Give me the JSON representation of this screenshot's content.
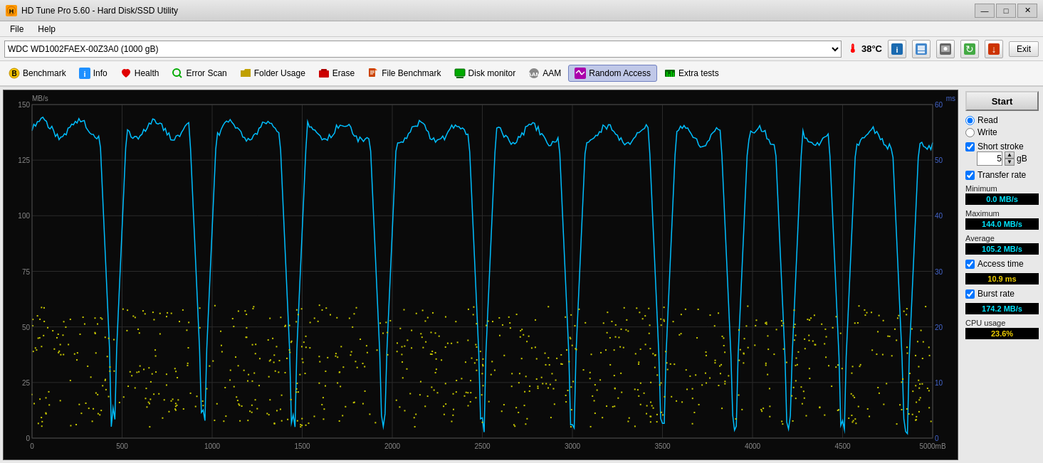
{
  "titlebar": {
    "icon": "HD",
    "title": "HD Tune Pro 5.60 - Hard Disk/SSD Utility",
    "minimize": "—",
    "maximize": "□",
    "close": "✕"
  },
  "menubar": {
    "items": [
      "File",
      "Help"
    ]
  },
  "toolbar": {
    "tabs": [
      {
        "id": "benchmark",
        "label": "Benchmark",
        "icon_color": "#f0c000",
        "active": false
      },
      {
        "id": "info",
        "label": "Info",
        "icon_color": "#1e90ff",
        "active": false
      },
      {
        "id": "health",
        "label": "Health",
        "icon_color": "#e00000",
        "active": false
      },
      {
        "id": "error-scan",
        "label": "Error Scan",
        "icon_color": "#00aa00",
        "active": false
      },
      {
        "id": "folder-usage",
        "label": "Folder Usage",
        "icon_color": "#c0a000",
        "active": false
      },
      {
        "id": "erase",
        "label": "Erase",
        "icon_color": "#cc0000",
        "active": false
      },
      {
        "id": "file-benchmark",
        "label": "File Benchmark",
        "icon_color": "#cc4400",
        "active": false
      },
      {
        "id": "disk-monitor",
        "label": "Disk monitor",
        "icon_color": "#00aa00",
        "active": false
      },
      {
        "id": "aam",
        "label": "AAM",
        "icon_color": "#888",
        "active": false
      },
      {
        "id": "random-access",
        "label": "Random Access",
        "icon_color": "#aa00aa",
        "active": true
      },
      {
        "id": "extra-tests",
        "label": "Extra tests",
        "icon_color": "#006600",
        "active": false
      }
    ]
  },
  "drivebar": {
    "drive_label": "WDC WD1002FAEX-00Z3A0 (1000 gB)",
    "temperature": "38°C",
    "exit_label": "Exit"
  },
  "chart": {
    "y_unit_left": "MB/s",
    "y_unit_right": "ms",
    "y_labels_left": [
      "150",
      "125",
      "100",
      "75",
      "50",
      "25",
      "0"
    ],
    "y_labels_right": [
      "60",
      "50",
      "40",
      "30",
      "20",
      "10"
    ],
    "x_labels": [
      "0",
      "500",
      "1000",
      "1500",
      "2000",
      "2500",
      "3000",
      "3500",
      "4000",
      "4500",
      "5000mB"
    ]
  },
  "right_panel": {
    "start_label": "Start",
    "read_label": "Read",
    "write_label": "Write",
    "short_stroke_label": "Short stroke",
    "short_stroke_value": "5",
    "short_stroke_unit": "gB",
    "transfer_rate_label": "Transfer rate",
    "minimum_label": "Minimum",
    "minimum_value": "0.0 MB/s",
    "maximum_label": "Maximum",
    "maximum_value": "144.0 MB/s",
    "average_label": "Average",
    "average_value": "105.2 MB/s",
    "access_time_label": "Access time",
    "access_time_value": "10.9 ms",
    "burst_rate_label": "Burst rate",
    "burst_rate_value": "174.2 MB/s",
    "cpu_usage_label": "CPU usage",
    "cpu_usage_value": "23.6%"
  }
}
